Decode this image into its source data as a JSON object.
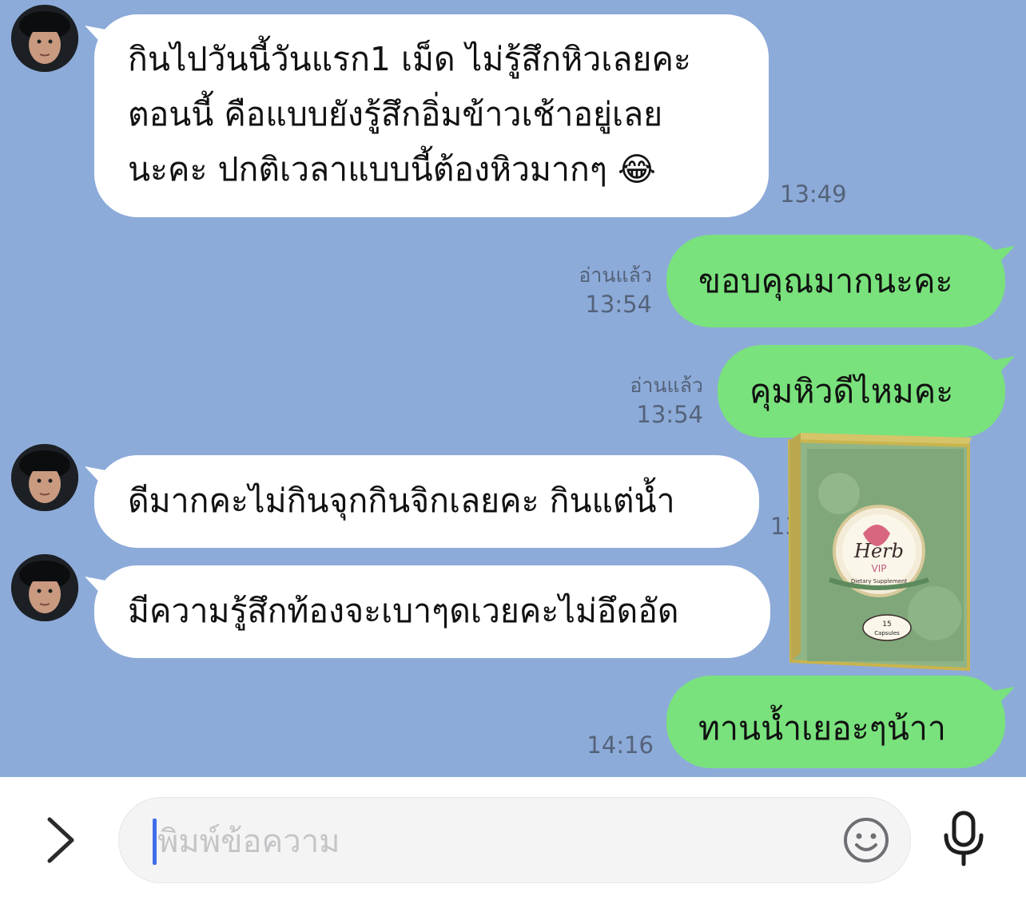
{
  "messages": [
    {
      "side": "in",
      "lines": [
        "กินไปวันนี้วันแรก1 เม็ด ไม่รู้สึกหิวเลยคะ",
        "ตอนนี้ คือแบบยังรู้สึกอิ่มข้าวเช้าอยู่เลย",
        "นะคะ ปกติเวลาแบบนี้ต้องหิวมากๆ 😂"
      ],
      "time": "13:49"
    },
    {
      "side": "out",
      "text": "ขอบคุณมากนะคะ",
      "read": "อ่านแล้ว",
      "time": "13:54"
    },
    {
      "side": "out",
      "text": "คุมหิวดีไหมคะ",
      "read": "อ่านแล้ว",
      "time": "13:54"
    },
    {
      "side": "in",
      "text": "ดีมากคะไม่กินจุกกินจิกเลยคะ กินแต่น้ำ",
      "time_partial": "13"
    },
    {
      "side": "in",
      "text": "มีความรู้สึกท้องจะเบาๆดเวยคะไม่อึดอัด"
    },
    {
      "side": "out",
      "text": "ทานน้ำเยอะๆน้าา",
      "time": "14:16"
    }
  ],
  "sticker": {
    "brand": "Herb",
    "line": "VIP",
    "caption": "Dietary Supplement",
    "count": "15",
    "unit": "Capsules"
  },
  "composer": {
    "placeholder": "พิมพ์ข้อความ",
    "icons": [
      "chevron-right-icon",
      "smiley-icon",
      "microphone-icon"
    ]
  },
  "colors": {
    "chat_background": "#8dabd9",
    "incoming_bubble": "#ffffff",
    "outgoing_bubble": "#79e27c",
    "caret": "#3e6ee8"
  }
}
